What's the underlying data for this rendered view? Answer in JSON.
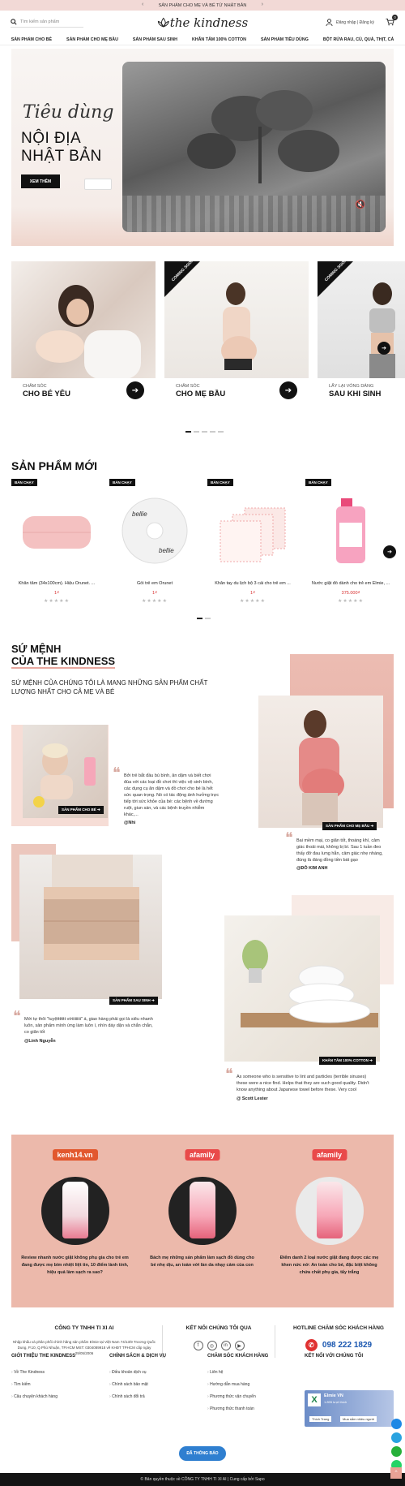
{
  "topbar": {
    "text": "SẢN PHẨM CHO MẸ VÀ BÉ TỪ NHẬT BẢN",
    "prev": "‹",
    "next": "›"
  },
  "header": {
    "search_placeholder": "Tìm kiếm sản phẩm",
    "logo": "the kindness",
    "account": "Đăng nhập | Đăng ký",
    "cart_count": "0"
  },
  "nav": [
    "SẢN PHẨM CHO BÉ",
    "SẢN PHẨM CHO MẸ BẦU",
    "SẢN PHẨM SAU SINH",
    "KHĂN TẮM 100% COTTON",
    "SẢN PHẨM TIÊU DÙNG",
    "BỘT RỬA RAU, CỦ, QUẢ, THỊT, CÁ"
  ],
  "hero": {
    "script": "Tiêu dùng",
    "line1": "NỘI ĐỊA",
    "line2": "NHẬT BẢN",
    "button": "XEM THÊM"
  },
  "categories": [
    {
      "small": "CHĂM SÓC",
      "large": "CHO BÉ YÊU",
      "coming": ""
    },
    {
      "small": "CHĂM SÓC",
      "large": "CHO MẸ BẦU",
      "coming": "COMING SOON"
    },
    {
      "small": "LẤY LẠI VÓNG DÁNG",
      "large": "SAU KHI SINH",
      "coming": "COMING SOON"
    }
  ],
  "products_title": "SẢN PHẨM MỚI",
  "products": [
    {
      "tag": "BÁN CHẠY",
      "name": "Khăn tắm (34x100cm). Hiệu Orunet. ...",
      "price": "1₫",
      "stars": "★★★★★"
    },
    {
      "tag": "BÁN CHẠY",
      "name": "Gối trẻ em Orunet",
      "price": "1₫",
      "stars": "★★★★★"
    },
    {
      "tag": "BÁN CHẠY",
      "name": "Khăn tay du lịch bộ 3 cái cho trẻ em ...",
      "price": "1₫",
      "stars": "★★★★★"
    },
    {
      "tag": "BÁN CHẠY",
      "name": "Nước giặt đồ dành cho trẻ em Elmie, ...",
      "price": "375.000₫",
      "stars": "★★★★★"
    }
  ],
  "mission": {
    "title1": "SỨ MỆNH",
    "title2": "CỦA THE KINDNESS",
    "subtitle": "SỨ MỆNH CỦA CHÚNG TÔI LÀ MANG NHỮNG SẢN PHẨM CHẤT LƯỢNG NHẤT CHO CẢ MẸ VÀ BÉ"
  },
  "testimonials": [
    {
      "label": "SẢN PHẨM CHO BÉ ➔",
      "quote": "Bởi trẻ bắt đầu bú bình, ăn dặm và biết chơi đùa với các loại đồ chơi thì việc vệ sinh bình, các dụng cụ ăn dặm và đồ chơi cho bé là hết sức quan trọng. Nó có tác động ảnh hưởng trực tiếp tới sức khỏe của bé: các bệnh về đường ruột, giun sán, và các bệnh truyền nhiễm khác,...",
      "author": "@Nhi"
    },
    {
      "label": "SẢN PHẨM CHO MẸ BẦU ➔",
      "quote": "Bai mềm mại, co giãn tốt, thoáng khí, cảm giác thoải mái, không bị bí. Sau 1 tuần đeo thấy đỡ đau lưng hẳn, cảm giác nhẹ nhàng, đúng là đáng đồng tiền bát gạo",
      "author": "@ĐỖ KIM ANH"
    },
    {
      "label": "SẢN PHẨM SAU SINH ➔",
      "quote": "Mới tự thôi \"tuyệttttttt vờiiiiiiiii\" á, giao hàng phải gọi là siêu nhanh luôn, sản phẩm mình ứng làm luôn í, nhìn dáy dặn và chắn chắn, co giãn tốt",
      "author": "@Linh Nguyễn"
    },
    {
      "label": "KHĂN TẮM 100% COTTON ➔",
      "quote": "As someone who is sensitive to lint and particles (terrible sinuses) these were a nice find. Helps that they are such good quality. Didn't know anything about Japanese towel before these. Very cool",
      "author": "@ Scott Lester"
    }
  ],
  "press": [
    {
      "logo": "kenh14.vn",
      "text": "Review nhanh nước giặt không phụ gia cho trẻ em đang được mẹ bỉm nhiệt liệt tin, 10 điểm lành tính, hiệu quả làm sạch ra sao?"
    },
    {
      "logo": "afamily",
      "text": "Bách mẹ những sản phẩm làm sạch đồ dùng cho bé nhẹ dịu, an toàn với làn da nhạy cảm của con"
    },
    {
      "logo": "afamily",
      "text": "Điểm danh 2 loại nước giặt đang được các mẹ khen nức nở: An toàn cho bé, đặc biệt không chứa chất phụ gia, tẩy trắng"
    }
  ],
  "footer": {
    "company": "CÔNG TY TNHH TI XI AI",
    "company_text": "Nhập khẩu và phân phối chính hãng sản phẩm Elmie tại Việt Nam 74/13/9 Trương Quốc Dung, P.10, Q.Phú Nhuận, TP.HCM MST: 0304089918 về KHĐT TPHCM cấp ngày 29/05/2006",
    "social_title": "KẾT NỐI CHÚNG TÔI QUA",
    "social": [
      "f",
      "◎",
      "in",
      "▶"
    ],
    "hotline_title": "HOTLINE CHĂM SÓC KHÁCH HÀNG",
    "hotline": "098 222 1829",
    "col1_title": "GIỚI THIỆU THE KINDNESS",
    "col1": [
      "Về The Kindness",
      "Tìm kiếm",
      "Câu chuyện khách hàng"
    ],
    "col2_title": "CHÍNH SÁCH & DỊCH VỤ",
    "col2": [
      "Điều khoản dịch vụ",
      "Chính sách bảo mật",
      "Chính sách đổi trả"
    ],
    "col3_title": "CHĂM SÓC KHÁCH HÀNG",
    "col3": [
      "Liên hệ",
      "Hướng dẫn mua hàng",
      "Phương thức vận chuyển",
      "Phương thức thanh toán"
    ],
    "col4_title": "KẾT NỐI VỚI CHÚNG TÔI",
    "fb_name": "Elmie VN",
    "fb_followers": "1.895 lượt thích",
    "fb_like": "Thích Trang",
    "fb_share": "Mua sắm nhiều người",
    "dmca": "ĐÃ THÔNG BÁO",
    "copyright": "© Bản quyền thuộc về CÔNG TY TNHH TI XI AI | Cung cấp bởi Sapo"
  }
}
